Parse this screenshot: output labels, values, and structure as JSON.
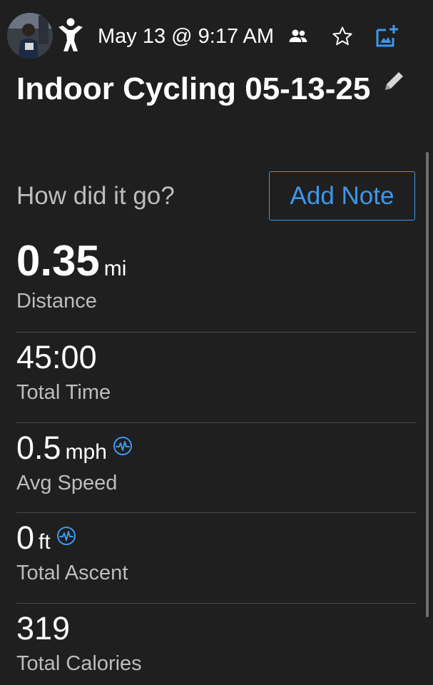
{
  "header": {
    "date_time": "May 13 @ 9:17 AM",
    "icons": {
      "avatar": "profile-photo",
      "activity": "person-stretching-icon",
      "people": "people-icon",
      "star": "star-icon",
      "add_photo": "add-photo-icon"
    }
  },
  "activity": {
    "title": "Indoor Cycling 05-13-25",
    "edit_icon": "pencil-icon"
  },
  "note": {
    "prompt": "How did it go?",
    "button_label": "Add Note"
  },
  "stats": {
    "distance": {
      "value": "0.35",
      "unit": "mi",
      "label": "Distance"
    },
    "total_time": {
      "value": "45:00",
      "label": "Total Time"
    },
    "avg_speed": {
      "value": "0.5",
      "unit": "mph",
      "label": "Avg Speed",
      "icon": "sensor-pulse-icon"
    },
    "total_ascent": {
      "value": "0",
      "unit": "ft",
      "label": "Total Ascent",
      "icon": "sensor-pulse-icon"
    },
    "total_calories": {
      "value": "319",
      "label": "Total Calories"
    }
  },
  "colors": {
    "background": "#1f1f1f",
    "accent": "#3d97ee",
    "label_gray": "#bdbdbd",
    "divider": "#4a4a4a"
  }
}
